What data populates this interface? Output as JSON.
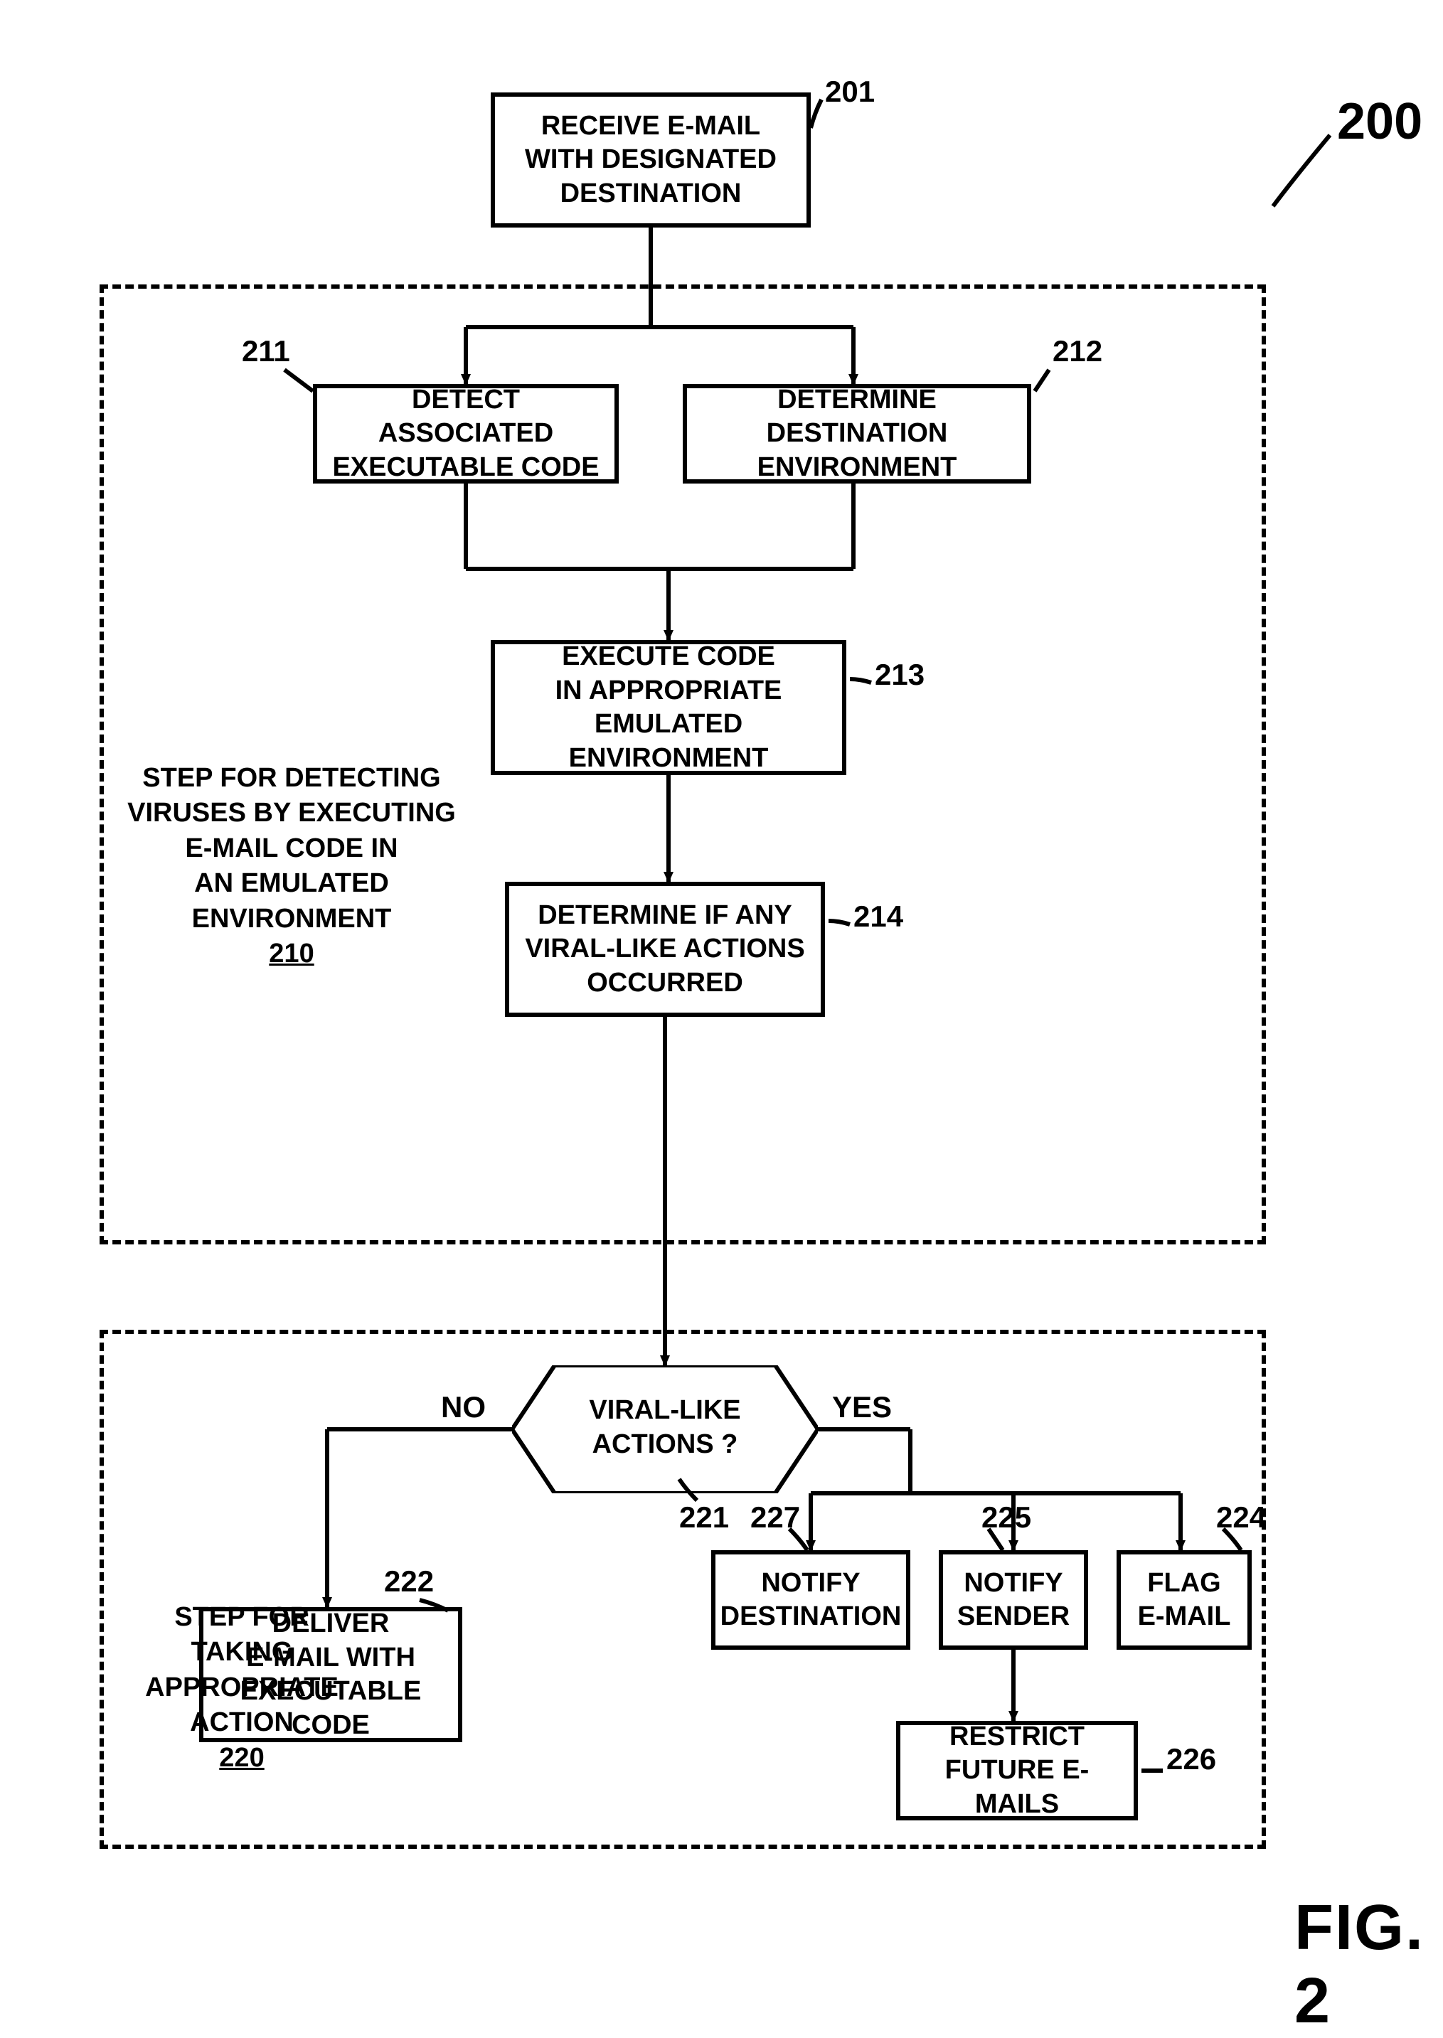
{
  "chart_data": {
    "type": "flowchart",
    "title": "FIG. 2",
    "overall_ref": "200",
    "regions": [
      {
        "id": "210",
        "label_lines": [
          "STEP FOR DETECTING",
          "VIRUSES BY EXECUTING",
          "E-MAIL CODE IN",
          "AN EMULATED ENVIRONMENT"
        ],
        "label_ref": "210"
      },
      {
        "id": "220",
        "label_lines": [
          "STEP FOR TAKING",
          "APPROPRIATE",
          "ACTION"
        ],
        "label_ref": "220"
      }
    ],
    "nodes": [
      {
        "id": "201",
        "type": "process",
        "text": "RECEIVE E-MAIL WITH DESIGNATED DESTINATION",
        "ref": "201"
      },
      {
        "id": "211",
        "type": "process",
        "text": "DETECT ASSOCIATED EXECUTABLE CODE",
        "ref": "211"
      },
      {
        "id": "212",
        "type": "process",
        "text": "DETERMINE DESTINATION ENVIRONMENT",
        "ref": "212"
      },
      {
        "id": "213",
        "type": "process",
        "text": "EXECUTE CODE IN APPROPRIATE EMULATED ENVIRONMENT",
        "ref": "213"
      },
      {
        "id": "214",
        "type": "process",
        "text": "DETERMINE IF ANY VIRAL-LIKE ACTIONS OCCURRED",
        "ref": "214"
      },
      {
        "id": "221",
        "type": "decision",
        "text": "VIRAL-LIKE ACTIONS ?",
        "ref": "221",
        "yes": "YES",
        "no": "NO"
      },
      {
        "id": "222",
        "type": "process",
        "text": "DELIVER E-MAIL WITH EXECUTABLE CODE",
        "ref": "222"
      },
      {
        "id": "227",
        "type": "process",
        "text": "NOTIFY DESTINATION",
        "ref": "227"
      },
      {
        "id": "225",
        "type": "process",
        "text": "NOTIFY SENDER",
        "ref": "225"
      },
      {
        "id": "224",
        "type": "process",
        "text": "FLAG E-MAIL",
        "ref": "224"
      },
      {
        "id": "226",
        "type": "process",
        "text": "RESTRICT FUTURE E-MAILS",
        "ref": "226"
      }
    ],
    "edges": [
      {
        "from": "201",
        "to": "211"
      },
      {
        "from": "201",
        "to": "212"
      },
      {
        "from": "211",
        "to": "213"
      },
      {
        "from": "212",
        "to": "213"
      },
      {
        "from": "213",
        "to": "214"
      },
      {
        "from": "214",
        "to": "221"
      },
      {
        "from": "221",
        "to": "222",
        "label": "NO"
      },
      {
        "from": "221",
        "to": "227",
        "label": "YES"
      },
      {
        "from": "221",
        "to": "225",
        "label": "YES"
      },
      {
        "from": "221",
        "to": "224",
        "label": "YES"
      },
      {
        "from": "225",
        "to": "226"
      }
    ]
  },
  "labels": {
    "b201": "RECEIVE E-MAIL\nWITH DESIGNATED\nDESTINATION",
    "b211": "DETECT ASSOCIATED\nEXECUTABLE CODE",
    "b212": "DETERMINE DESTINATION\nENVIRONMENT",
    "b213": "EXECUTE CODE\nIN APPROPRIATE\nEMULATED ENVIRONMENT",
    "b214": "DETERMINE IF ANY\nVIRAL-LIKE ACTIONS\nOCCURRED",
    "d221": "VIRAL-LIKE\nACTIONS ?",
    "b222": "DELIVER\nE-MAIL WITH\nEXECUTABLE CODE",
    "b227": "NOTIFY\nDESTINATION",
    "b225": "NOTIFY\nSENDER",
    "b224": "FLAG\nE-MAIL",
    "b226": "RESTRICT\nFUTURE E-MAILS",
    "no": "NO",
    "yes": "YES",
    "region210_l1": "STEP FOR DETECTING",
    "region210_l2": "VIRUSES BY EXECUTING",
    "region210_l3": "E-MAIL CODE IN",
    "region210_l4": "AN EMULATED ENVIRONMENT",
    "region210_ref": "210",
    "region220_l1": "STEP FOR TAKING",
    "region220_l2": "APPROPRIATE",
    "region220_l3": "ACTION",
    "region220_ref": "220",
    "ref200": "200",
    "r201": "201",
    "r211": "211",
    "r212": "212",
    "r213": "213",
    "r214": "214",
    "r221": "221",
    "r222": "222",
    "r227": "227",
    "r225": "225",
    "r224": "224",
    "r226": "226",
    "fig": "FIG. 2"
  }
}
